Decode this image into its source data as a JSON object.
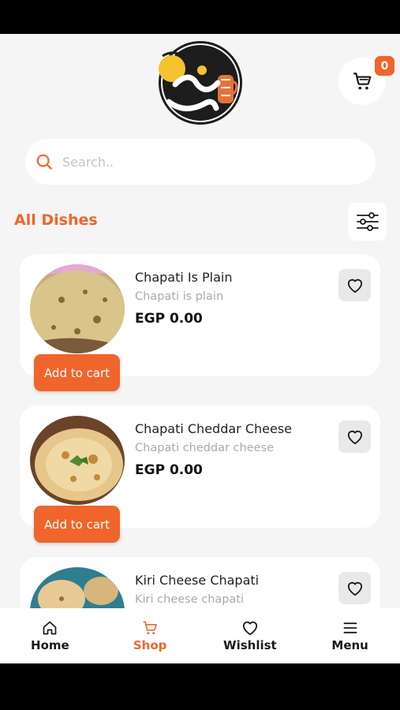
{
  "header": {
    "cart_count": "0",
    "logo_icon": "brand-logo"
  },
  "search": {
    "placeholder": "Search.."
  },
  "section": {
    "title": "All Dishes"
  },
  "dishes": [
    {
      "name": "Chapati Is Plain",
      "description": "Chapati is plain",
      "price": "EGP 0.00",
      "add_label": "Add to cart"
    },
    {
      "name": "Chapati Cheddar Cheese",
      "description": "Chapati cheddar cheese",
      "price": "EGP 0.00",
      "add_label": "Add to cart"
    },
    {
      "name": "Kiri Cheese Chapati",
      "description": "Kiri cheese chapati",
      "price": "",
      "add_label": ""
    }
  ],
  "nav": {
    "items": [
      {
        "label": "Home",
        "icon": "home-icon"
      },
      {
        "label": "Shop",
        "icon": "cart-icon"
      },
      {
        "label": "Wishlist",
        "icon": "heart-icon"
      },
      {
        "label": "Menu",
        "icon": "menu-icon"
      }
    ],
    "active": "Shop"
  },
  "colors": {
    "accent": "#f0652b",
    "background": "#f5f5f5"
  }
}
